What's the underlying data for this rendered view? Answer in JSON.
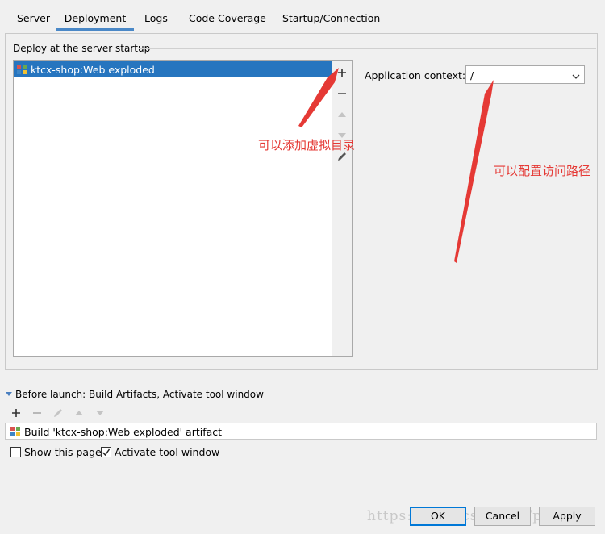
{
  "tabs": [
    {
      "label": "Server"
    },
    {
      "label": "Deployment"
    },
    {
      "label": "Logs"
    },
    {
      "label": "Code Coverage"
    },
    {
      "label": "Startup/Connection"
    }
  ],
  "active_tab": "Deployment",
  "deploy": {
    "title": "Deploy at the server startup",
    "items": [
      {
        "label": "ktcx-shop:Web exploded",
        "selected": true
      }
    ],
    "toolbar": [
      {
        "icon": "plus-icon"
      },
      {
        "icon": "minus-icon"
      },
      {
        "icon": "arrow-up-icon"
      },
      {
        "icon": "arrow-down-icon"
      },
      {
        "icon": "pencil-icon"
      }
    ]
  },
  "context": {
    "label": "Application context:",
    "value": "/"
  },
  "annotations": {
    "add_dir": "可以添加虚拟目录",
    "config_path": "可以配置访问路径",
    "color": "#e53935"
  },
  "before_launch": {
    "title": "Before launch: Build Artifacts, Activate tool window",
    "items": [
      {
        "label": "Build 'ktcx-shop:Web exploded' artifact"
      }
    ]
  },
  "checkboxes": {
    "show_page": {
      "label": "Show this page",
      "checked": false
    },
    "activate": {
      "label": "Activate tool window",
      "checked": true
    }
  },
  "buttons": {
    "ok": "OK",
    "cancel": "Cancel",
    "apply": "Apply"
  },
  "watermark": "https://blog.csdn.net/pnnsf",
  "colors": {
    "selection": "#2675bf",
    "tab_underline": "#4a88c7",
    "window_bg": "#f0f0f0"
  }
}
